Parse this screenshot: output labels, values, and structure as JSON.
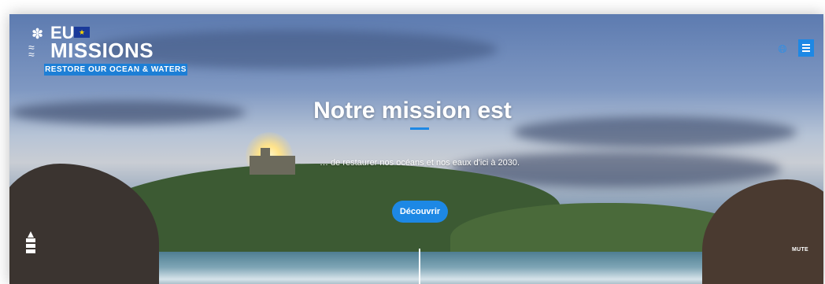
{
  "logo": {
    "eu": "EU",
    "missions": "MISSIONS",
    "tagline": "RESTORE OUR OCEAN & WATERS",
    "flag_icon": "eu-flag-icon",
    "emblem_icon": "water-drop-waves-icon"
  },
  "header": {
    "language_icon": "globe-icon",
    "menu_icon": "menu-icon"
  },
  "hero": {
    "title": "Notre mission est",
    "subtitle": "… de restaurer nos océans et nos eaux d'ici à 2030.",
    "cta_label": "Découvrir"
  },
  "footer": {
    "lighthouse_icon": "lighthouse-icon",
    "mute_label": "MUTE"
  },
  "colors": {
    "accent": "#1d88e5",
    "text_light": "#ffffff"
  }
}
